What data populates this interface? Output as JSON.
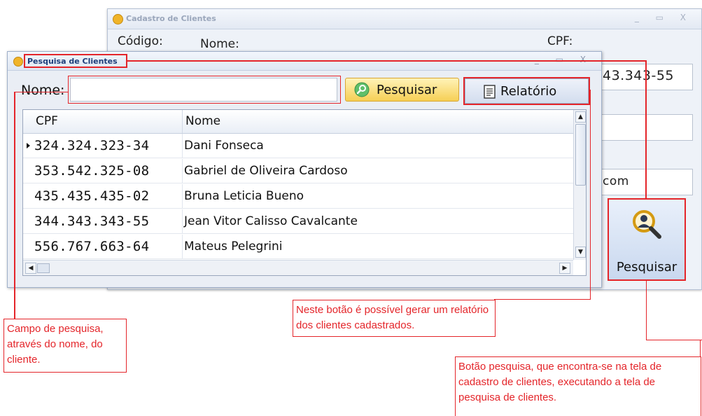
{
  "back_window": {
    "title": "Cadastro de Clientes",
    "labels": {
      "codigo": "Código:",
      "nome": "Nome:",
      "cpf": "CPF:"
    },
    "fields": {
      "cpf_value": "43.343-55",
      "email_value": "com"
    },
    "search_button_label": "Pesquisar",
    "window_controls": "_ ▭ X"
  },
  "front_window": {
    "title": "Pesquisa de Clientes",
    "window_controls": "_ ▭ X",
    "nome_label": "Nome:",
    "nome_input_value": "",
    "pesquisar_label": "Pesquisar",
    "relatorio_label": "Relatório",
    "grid": {
      "columns": [
        "CPF",
        "Nome"
      ],
      "rows": [
        {
          "cpf": "324.324.323-34",
          "nome": "Dani Fonseca",
          "current": true
        },
        {
          "cpf": "353.542.325-08",
          "nome": "Gabriel de Oliveira Cardoso",
          "current": false
        },
        {
          "cpf": "435.435.435-02",
          "nome": "Bruna Leticia Bueno",
          "current": false
        },
        {
          "cpf": "344.343.343-55",
          "nome": "Jean Vitor Calisso Cavalcante",
          "current": false
        },
        {
          "cpf": "556.767.663-64",
          "nome": "Mateus Pelegrini",
          "current": false
        }
      ]
    }
  },
  "annotations": {
    "campo": "Campo de pesquisa, através do nome, do cliente.",
    "relatorio": "Neste botão é possível gerar um relatório dos clientes cadastrados.",
    "pesquisa": "Botão pesquisa, que encontra-se na tela de cadastro de clientes, executando a tela de pesquisa de clientes."
  },
  "colors": {
    "annotation_red": "#e4252a",
    "title_blue": "#1d3d7a",
    "button_gold": "#f6cf55"
  }
}
